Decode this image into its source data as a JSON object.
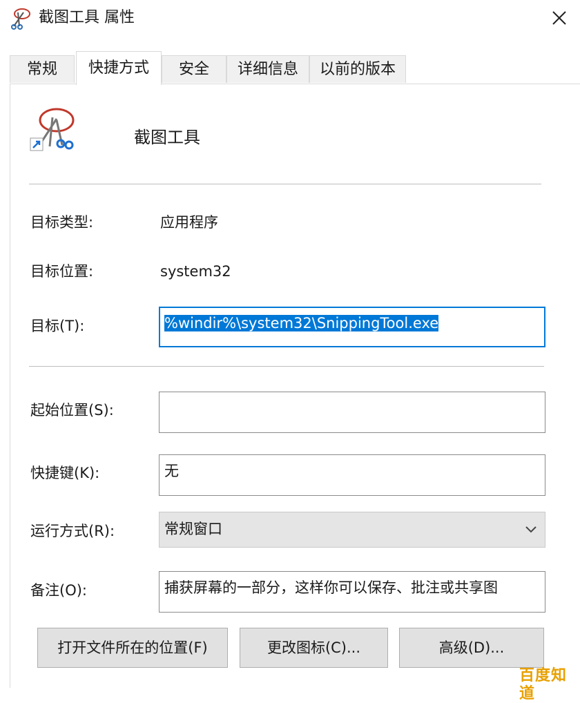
{
  "window": {
    "title": "截图工具 属性",
    "app_icon": "scissors-icon",
    "close_icon": "close-icon"
  },
  "tabs": [
    {
      "label": "常规"
    },
    {
      "label": "快捷方式",
      "active": true
    },
    {
      "label": "安全"
    },
    {
      "label": "详细信息"
    },
    {
      "label": "以前的版本"
    }
  ],
  "shortcut": {
    "icon": "snipping-tool-icon",
    "app_name": "截图工具",
    "target_type_label": "目标类型:",
    "target_type_value": "应用程序",
    "target_location_label": "目标位置:",
    "target_location_value": "system32",
    "target_label": "目标(T):",
    "target_value": "%windir%\\system32\\SnippingTool.exe",
    "start_in_label": "起始位置(S):",
    "start_in_value": "",
    "hotkey_label": "快捷键(K):",
    "hotkey_value": "无",
    "run_label": "运行方式(R):",
    "run_value": "常规窗口",
    "comment_label": "备注(O):",
    "comment_value": "捕获屏幕的一部分，这样你可以保存、批注或共享图",
    "buttons": {
      "open_location": "打开文件所在的位置(F)",
      "change_icon": "更改图标(C)...",
      "advanced": "高级(D)..."
    }
  },
  "watermark": "百度知道",
  "colors": {
    "accent": "#0078d7",
    "watermark": "#e8a000"
  }
}
